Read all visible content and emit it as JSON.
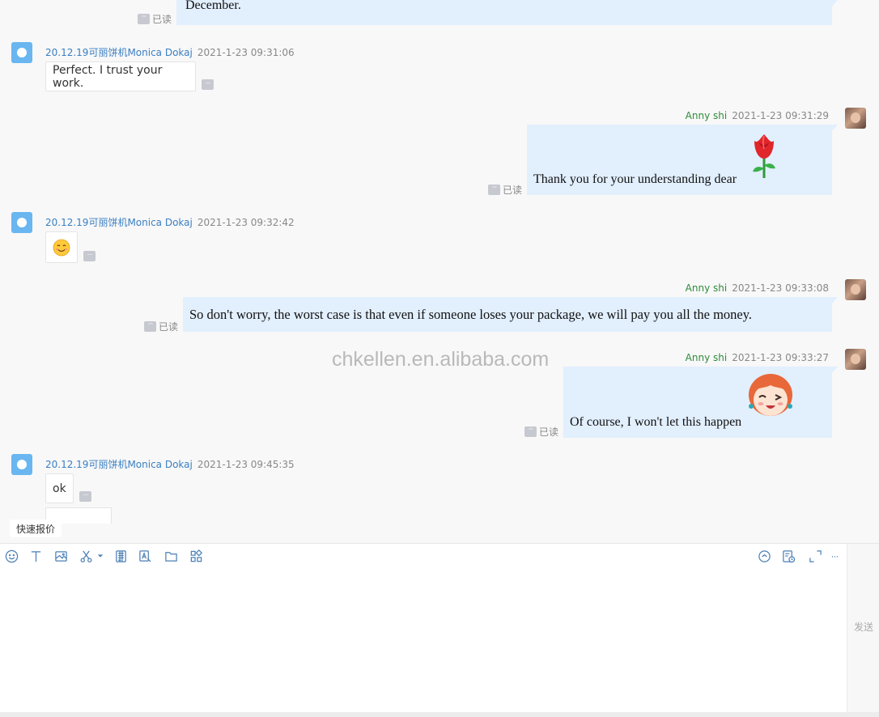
{
  "messages": [
    {
      "side": "right",
      "text": "December.",
      "read_label": "已读",
      "more": "···"
    },
    {
      "side": "left",
      "sender": "20.12.19可丽饼机Monica Dokaj",
      "time": "2021-1-23 09:31:06",
      "text": "Perfect. I trust your work.",
      "more": "···"
    },
    {
      "side": "right",
      "sender": "Anny shi",
      "time": "2021-1-23 09:31:29",
      "text": "Thank you for your understanding dear",
      "sticker": "rose",
      "read_label": "已读",
      "more": "···"
    },
    {
      "side": "left",
      "sender": "20.12.19可丽饼机Monica Dokaj",
      "time": "2021-1-23 09:32:42",
      "text": "😊",
      "more": "···"
    },
    {
      "side": "right",
      "sender": "Anny shi",
      "time": "2021-1-23 09:33:08",
      "text": "So don't worry, the worst case is that even if someone loses your package, we will pay you all the money.",
      "read_label": "已读",
      "more": "···"
    },
    {
      "side": "right",
      "sender": "Anny shi",
      "time": "2021-1-23 09:33:27",
      "text": "Of course, I won't let this happen",
      "sticker": "winking-girl",
      "read_label": "已读",
      "more": "···"
    },
    {
      "side": "left",
      "sender": "20.12.19可丽饼机Monica Dokaj",
      "time": "2021-1-23 09:45:35",
      "text": "ok",
      "more": "···"
    }
  ],
  "watermark": "chkellen.en.alibaba.com",
  "quick_quote": "快速报价",
  "toolbar": {
    "left_icons": [
      "emoji-icon",
      "text-format-icon",
      "image-icon",
      "screenshot-icon",
      "order-icon",
      "translate-icon",
      "folder-icon",
      "apps-icon"
    ],
    "right_icons": [
      "quick-reply-icon",
      "history-icon",
      "expand-icon",
      "more-icon"
    ],
    "more_label": "···"
  },
  "send_label": "发送",
  "colors": {
    "left_name": "#3a7fc2",
    "right_name": "#2e8b3a",
    "right_bubble": "#e2effd",
    "icon": "#4a7fb5"
  }
}
